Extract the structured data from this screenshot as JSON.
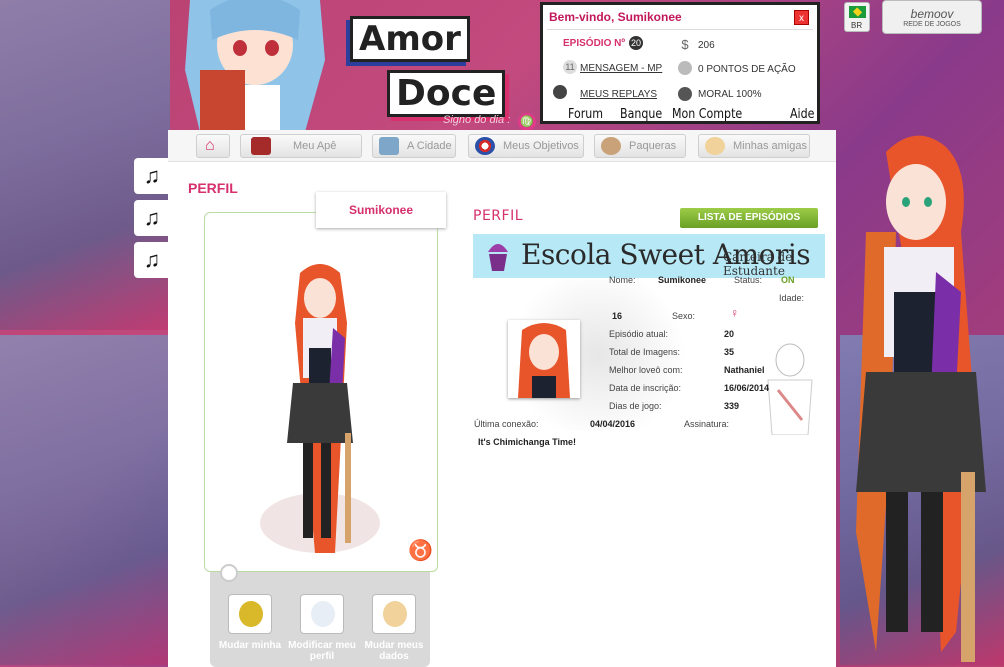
{
  "header": {
    "logo_line1": "Amor",
    "logo_line2": "Doce",
    "sign_of_day": "Signo do dia :",
    "sign_icon": "♍"
  },
  "welcome": {
    "title": "Bem-vindo, Sumikonee",
    "close": "x",
    "episode_label": "EPISÓDIO Nº",
    "episode_number": "20",
    "money": "206",
    "messages_count": "11",
    "messages_link": "MENSAGEM - MP",
    "action_points": "0 PONTOS DE AÇÃO",
    "replays_link": "MEUS REPLAYS",
    "moral": "MORAL 100%"
  },
  "topnav": [
    {
      "label": "Forum"
    },
    {
      "label": "Banque"
    },
    {
      "label": "Mon Compte"
    },
    {
      "label": "Aide"
    }
  ],
  "lang": {
    "code": "BR"
  },
  "network": {
    "brand": "bemoov",
    "tagline": "REDE DE JOGOS"
  },
  "tabs": [
    {
      "label": ""
    },
    {
      "label": "Meu Apê"
    },
    {
      "label": "A Cidade"
    },
    {
      "label": "Meus Objetivos"
    },
    {
      "label": "Paqueras"
    },
    {
      "label": "Minhas amigas"
    }
  ],
  "music_icon": "♫",
  "profile": {
    "page_title": "PERFIL",
    "username": "Sumikonee",
    "zodiac": "♉",
    "actions": [
      {
        "label": "Mudar minha"
      },
      {
        "label": "Modificar meu perfil"
      },
      {
        "label": "Mudar meus dados"
      }
    ]
  },
  "card": {
    "section_title": "PERFIL",
    "episodes_button": "LISTA DE EPISÓDIOS",
    "school": "Escola Sweet Amoris",
    "card_type": "Carteira de Estudante",
    "name_label": "Nome:",
    "name_value": "Sumikonee",
    "status_label": "Status:",
    "status_value": "ON",
    "age_label": "Idade:",
    "age_value": "16",
    "sex_label": "Sexo:",
    "sex_value": "♀",
    "episode_label": "Episódio atual:",
    "episode_value": "20",
    "images_label": "Total de Imagens:",
    "images_value": "35",
    "love_label": "Melhor loveô com:",
    "love_value": "Nathaniel",
    "signup_label": "Data de inscrição:",
    "signup_value": "16/06/2014",
    "days_label": "Dias de jogo:",
    "days_value": "339",
    "lastlogin_label": "Última conexão:",
    "lastlogin_value": "04/04/2016",
    "signature_label": "Assinatura:",
    "signature_value": "It's Chimichanga Time!"
  },
  "colors": {
    "accent": "#d6306d",
    "green": "#7bb32e",
    "card_blue": "#b7e8f5"
  }
}
